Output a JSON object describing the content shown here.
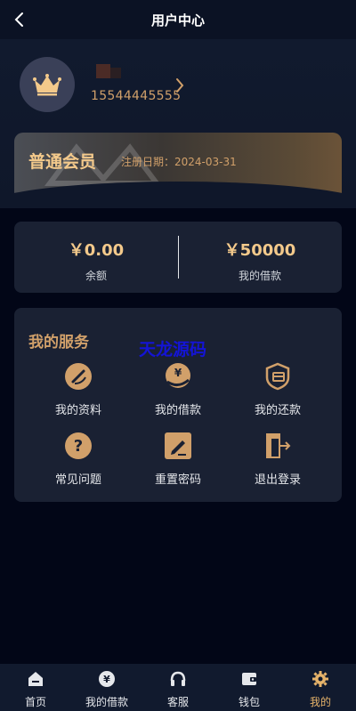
{
  "topbar": {
    "title": "用户中心"
  },
  "profile": {
    "phone": "15544445555"
  },
  "member": {
    "title": "普通会员",
    "reg_date": "注册日期：2024-03-31"
  },
  "balance": {
    "left": {
      "value": "￥0.00",
      "label": "余额"
    },
    "right": {
      "value": "￥50000",
      "label": "我的借款"
    }
  },
  "services": {
    "title": "我的服务",
    "watermark": "天龙源码",
    "items": [
      {
        "label": "我的资料",
        "icon": "edit-circle-icon"
      },
      {
        "label": "我的借款",
        "icon": "yen-hand-icon"
      },
      {
        "label": "我的还款",
        "icon": "shield-card-icon"
      },
      {
        "label": "常见问题",
        "icon": "question-icon"
      },
      {
        "label": "重置密码",
        "icon": "pencil-square-icon"
      },
      {
        "label": "退出登录",
        "icon": "logout-icon"
      }
    ]
  },
  "tabbar": {
    "items": [
      {
        "label": "首页",
        "icon": "home-icon"
      },
      {
        "label": "我的借款",
        "icon": "yen-icon"
      },
      {
        "label": "客服",
        "icon": "headset-icon"
      },
      {
        "label": "钱包",
        "icon": "wallet-icon"
      },
      {
        "label": "我的",
        "icon": "gear-icon",
        "active": true
      }
    ]
  },
  "colors": {
    "accent": "#d1a06a",
    "gold": "#f3c98b",
    "background": "#020617",
    "card": "#1a2133"
  }
}
